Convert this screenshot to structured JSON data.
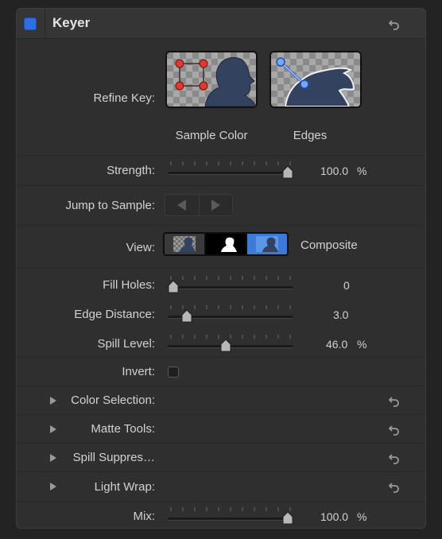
{
  "header": {
    "title": "Keyer"
  },
  "refine_key": {
    "label": "Refine Key:",
    "sample_color_caption": "Sample Color",
    "edges_caption": "Edges"
  },
  "strength": {
    "label": "Strength:",
    "value": "100.0",
    "unit": "%",
    "level": 1.0
  },
  "jump_to_sample": {
    "label": "Jump to Sample:"
  },
  "view": {
    "label": "View:",
    "mode": "Composite"
  },
  "fill_holes": {
    "label": "Fill Holes:",
    "value": "0",
    "level": 0.0
  },
  "edge_distance": {
    "label": "Edge Distance:",
    "value": "3.0",
    "level": 0.12
  },
  "spill_level": {
    "label": "Spill Level:",
    "value": "46.0",
    "unit": "%",
    "level": 0.46
  },
  "invert": {
    "label": "Invert:",
    "checked": false
  },
  "groups": {
    "color_selection": "Color Selection:",
    "matte_tools": "Matte Tools:",
    "spill_suppression": "Spill Suppres…",
    "light_wrap": "Light Wrap:"
  },
  "mix": {
    "label": "Mix:",
    "value": "100.0",
    "unit": "%",
    "level": 1.0
  },
  "colors": {
    "accent": "#2f6ee0",
    "panel": "#2f2f2f",
    "silhouette": "#33425e"
  }
}
